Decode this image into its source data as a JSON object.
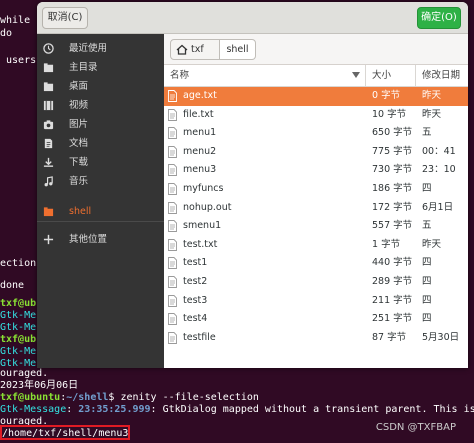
{
  "terminal": {
    "lines_top": [
      {
        "text": "while",
        "y": 0
      },
      {
        "text": "do",
        "y": 1
      },
      {
        "text": " users",
        "y": 2
      }
    ],
    "lines_mid": [
      {
        "text": "ection\"",
        "y": 0
      },
      {
        "text": "done",
        "y": 1
      }
    ],
    "prompt_user_host": "txf@ub",
    "gtk_fragment": "Gtk-Me",
    "prompt_full_user_host": "txf@ubuntu",
    "prompt_path": "~/shell",
    "command": "zenity --file-selection",
    "discouraged_fragment": "ouraged.",
    "date_line": "2023年06月06日",
    "gtk_message_label": "Gtk-Message",
    "gtk_message_time": "23:35:25.999",
    "gtk_message_text": ": GtkDialog mapped without a transient parent. This is d",
    "discouraged_line": "ouraged.",
    "result_path": "/home/txf/shell/menu3",
    "watermark": "CSDN @TXFBAP"
  },
  "dialog": {
    "cancel_label": "取消(C)",
    "confirm_label": "确定(O)",
    "colors": {
      "accent": "#f07c3c",
      "confirm": "#2eb146",
      "sidebar": "#343434"
    }
  },
  "sidebar": {
    "items": [
      {
        "label": "最近使用",
        "icon": "clock-icon"
      },
      {
        "label": "主目录",
        "icon": "home-icon"
      },
      {
        "label": "桌面",
        "icon": "folder-icon"
      },
      {
        "label": "视频",
        "icon": "video-icon"
      },
      {
        "label": "图片",
        "icon": "camera-icon"
      },
      {
        "label": "文档",
        "icon": "document-icon"
      },
      {
        "label": "下载",
        "icon": "download-icon"
      },
      {
        "label": "音乐",
        "icon": "music-icon"
      },
      {
        "label": "shell",
        "icon": "folder-icon",
        "active": true
      },
      {
        "label": "其他位置",
        "icon": "plus-icon"
      }
    ]
  },
  "pathbar": {
    "home_label": "txf",
    "current_label": "shell"
  },
  "columns": {
    "name": "名称",
    "size": "大小",
    "modified": "修改日期"
  },
  "files": [
    {
      "name": "age.txt",
      "size": "0 字节",
      "modified": "昨天",
      "selected": true,
      "icon": "text-file-icon"
    },
    {
      "name": "file.txt",
      "size": "10 字节",
      "modified": "昨天",
      "icon": "text-file-icon"
    },
    {
      "name": "menu1",
      "size": "650 字节",
      "modified": "五",
      "icon": "script-file-icon"
    },
    {
      "name": "menu2",
      "size": "775 字节",
      "modified": "00：41",
      "icon": "script-file-icon"
    },
    {
      "name": "menu3",
      "size": "730 字节",
      "modified": "23：10",
      "icon": "script-file-icon"
    },
    {
      "name": "myfuncs",
      "size": "186 字节",
      "modified": "四",
      "icon": "script-file-icon"
    },
    {
      "name": "nohup.out",
      "size": "172 字节",
      "modified": "6月1日",
      "icon": "text-file-icon"
    },
    {
      "name": "smenu1",
      "size": "557 字节",
      "modified": "五",
      "icon": "script-file-icon"
    },
    {
      "name": "test.txt",
      "size": "1 字节",
      "modified": "昨天",
      "icon": "text-file-icon"
    },
    {
      "name": "test1",
      "size": "440 字节",
      "modified": "四",
      "icon": "script-file-icon"
    },
    {
      "name": "test2",
      "size": "289 字节",
      "modified": "四",
      "icon": "script-file-icon"
    },
    {
      "name": "test3",
      "size": "211 字节",
      "modified": "四",
      "icon": "script-file-icon"
    },
    {
      "name": "test4",
      "size": "251 字节",
      "modified": "四",
      "icon": "script-file-icon"
    },
    {
      "name": "testfile",
      "size": "87 字节",
      "modified": "5月30日",
      "icon": "text-file-icon"
    }
  ]
}
